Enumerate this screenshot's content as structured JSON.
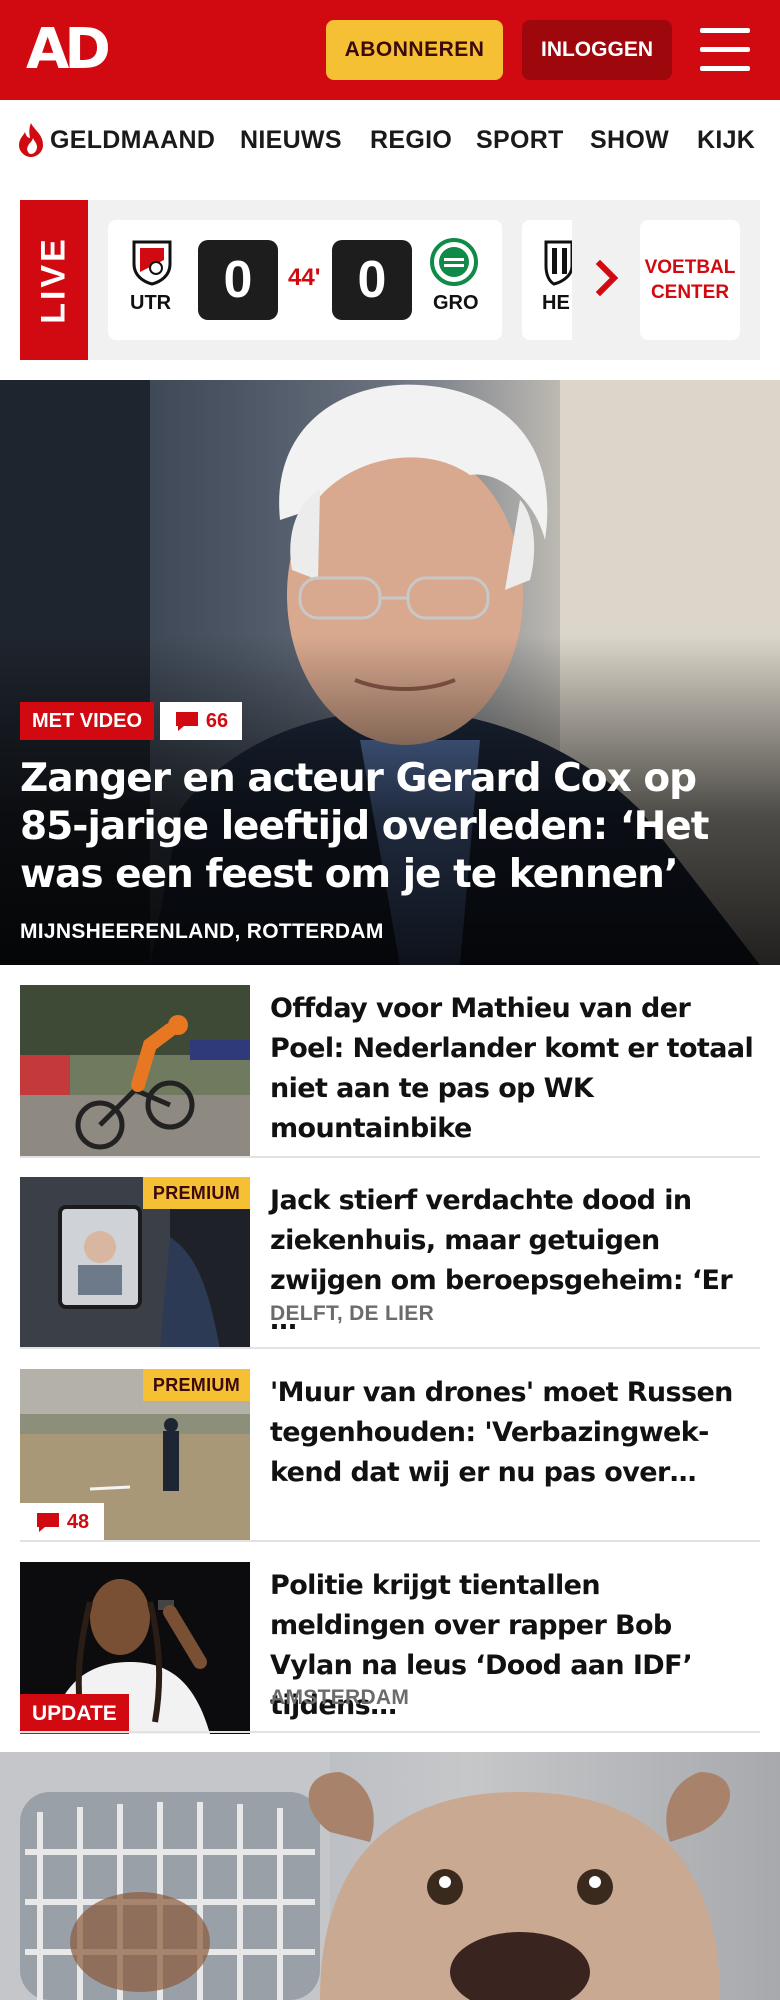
{
  "header": {
    "logo": "AD",
    "subscribe_label": "ABONNEREN",
    "login_label": "INLOGGEN",
    "accent_color": "#d10a11",
    "subscribe_color": "#f6c035",
    "menu_icon": "hamburger-icon"
  },
  "nav": {
    "items": [
      "GELDMAAND",
      "NIEUWS",
      "REGIO",
      "SPORT",
      "SHOW",
      "KIJK"
    ],
    "first_icon": "flame-icon"
  },
  "live": {
    "label": "LIVE",
    "match": {
      "home": "UTR",
      "home_score": "0",
      "minute": "44'",
      "away_score": "0",
      "away": "GRO"
    },
    "next_match_home": "HE",
    "voetbal_center": [
      "VOETBAL",
      "CENTER"
    ]
  },
  "hero": {
    "badge": "MET VIDEO",
    "comments": "66",
    "title": "Zanger en acteur Gerard Cox op 85-jarige leeftijd overleden: ‘Het was een feest om je te kennen’",
    "location": "MIJNSHEERENLAND, ROTTERDAM"
  },
  "articles": [
    {
      "title": "Offday voor Mathieu van der Poel: Nederlander komt er totaal niet aan te pas op WK mountainbike",
      "location": "",
      "badge": ""
    },
    {
      "title": "Jack stierf verdachte dood in ziekenhuis, maar getuigen zwijgen om beroepsgeheim: ‘Er …",
      "location": "DELFT, DE LIER",
      "badge": "PREMIUM"
    },
    {
      "title": "'Muur van drones' moet Russen tegenhouden: 'Verbazingwek-kend dat wij er nu pas over…",
      "location": "",
      "badge": "PREMIUM",
      "comments": "48"
    },
    {
      "title": "Politie krijgt tientallen meldingen over rapper Bob Vylan na leus ‘Dood aan IDF’ tijdens…",
      "location": "AMSTERDAM",
      "badge": "UPDATE"
    }
  ]
}
